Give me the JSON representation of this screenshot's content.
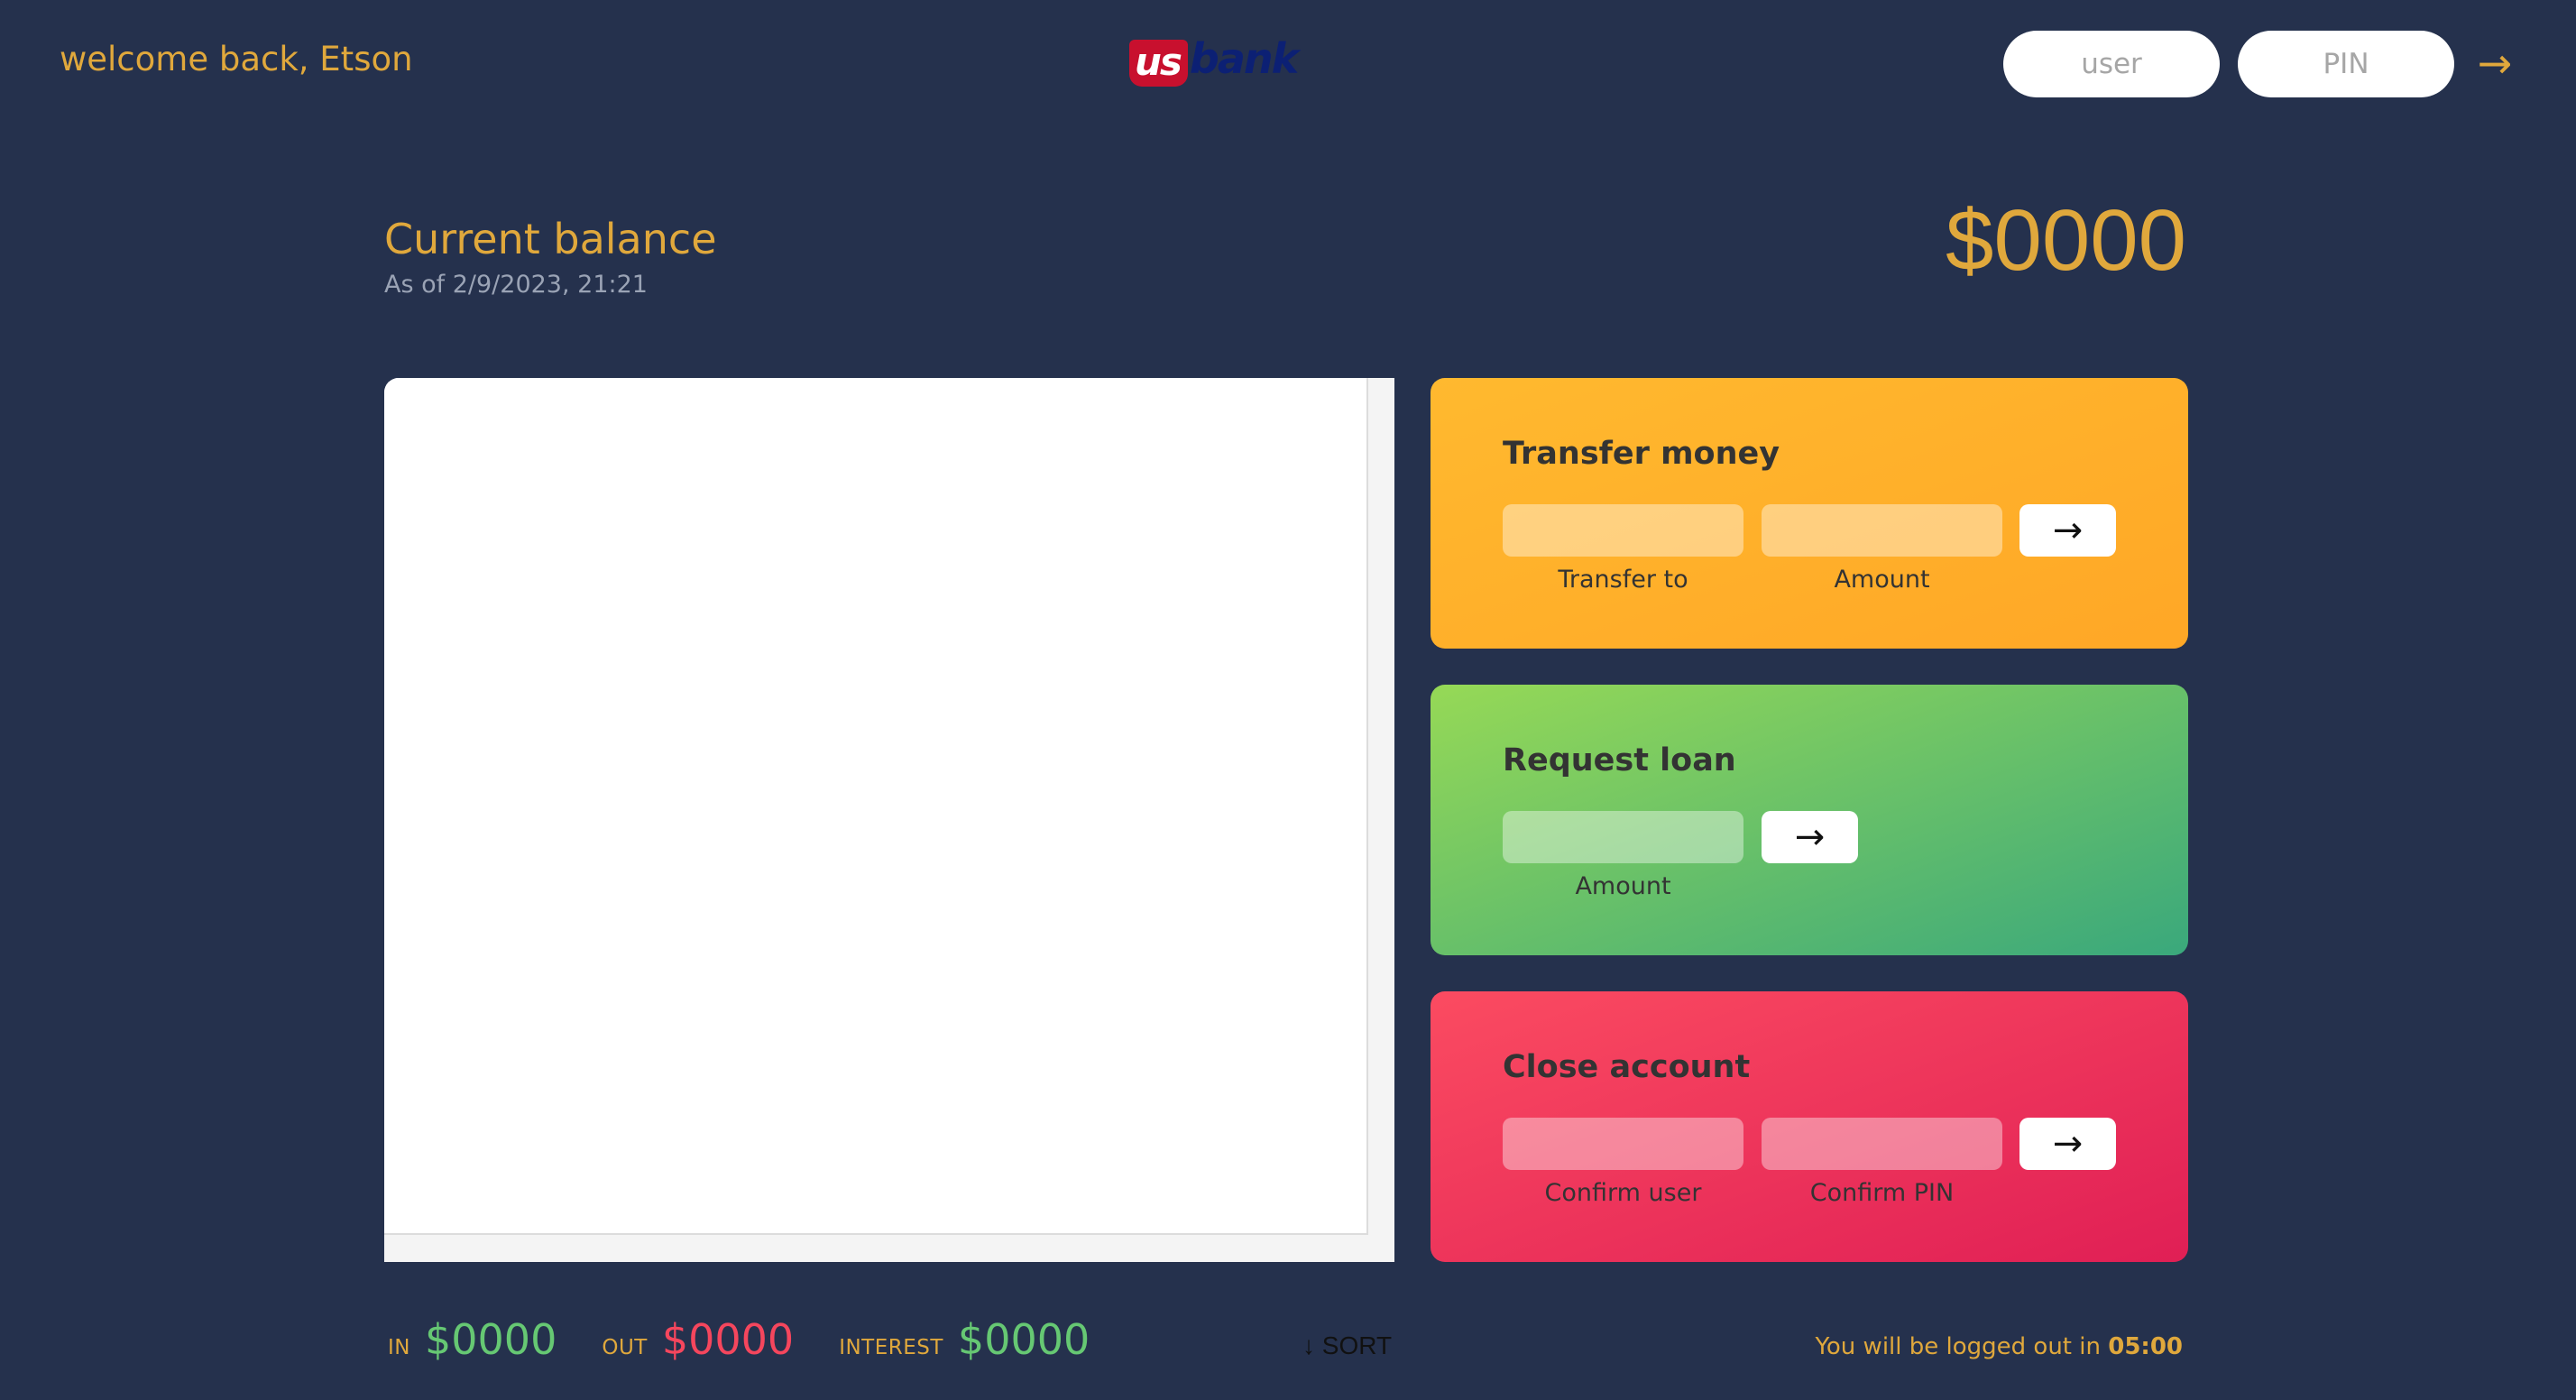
{
  "header": {
    "welcome_text": "welcome back, Etson",
    "logo": {
      "part1": "us",
      "part2": "bank"
    },
    "login": {
      "user_placeholder": "user",
      "pin_placeholder": "PIN",
      "submit_label": "→"
    }
  },
  "balance": {
    "label": "Current balance",
    "date": "As of 2/9/2023, 21:21",
    "value": "$0000"
  },
  "movements": [],
  "operations": {
    "transfer": {
      "title": "Transfer money",
      "to_label": "Transfer to",
      "amount_label": "Amount",
      "submit_label": "→"
    },
    "loan": {
      "title": "Request loan",
      "amount_label": "Amount",
      "submit_label": "→"
    },
    "close": {
      "title": "Close account",
      "user_label": "Confirm user",
      "pin_label": "Confirm PIN",
      "submit_label": "→"
    }
  },
  "summary": {
    "in_label": "IN",
    "in_value": "$0000",
    "out_label": "OUT",
    "out_value": "$0000",
    "interest_label": "INTEREST",
    "interest_value": "$0000",
    "sort_label": "↓ SORT"
  },
  "logout": {
    "prefix": "You will be logged out in ",
    "timer": "05:00"
  },
  "colors": {
    "background": "#25314d",
    "accent": "#e0a83c",
    "transfer": "#ffb92f",
    "loan": "#96d956",
    "close": "#fb4b61",
    "deposit": "#66c873",
    "withdrawal": "#f5465d"
  }
}
